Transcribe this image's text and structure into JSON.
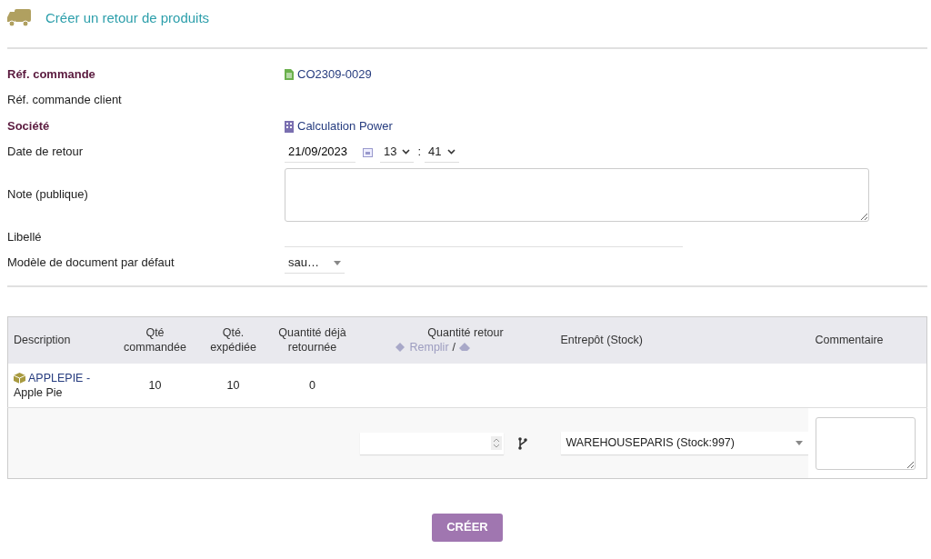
{
  "page_title": "Créer un retour de produits",
  "fields": [
    {
      "kind": "doc-link",
      "label": "Réf. commande",
      "required": true,
      "value": "CO2309-0029"
    },
    {
      "kind": "empty",
      "label": "Réf. commande client",
      "required": false
    },
    {
      "kind": "company-link",
      "label": "Société",
      "required": true,
      "value": "Calculation Power"
    },
    {
      "kind": "datetime",
      "label": "Date de retour",
      "required": false,
      "date": "21/09/2023",
      "hour": "13",
      "separator": ":",
      "minute": "41"
    },
    {
      "kind": "textarea",
      "label": "Note (publique)",
      "required": false
    },
    {
      "kind": "text",
      "label": "Libellé",
      "required": false
    },
    {
      "kind": "select",
      "label": "Modèle de document par défaut",
      "required": false,
      "value": "sau…"
    }
  ],
  "table": {
    "columns": [
      "Description",
      "Qté commandée",
      "Qté. expédiée",
      "Quantité déjà retournée",
      "Quantité retour",
      "Entrepôt (Stock)",
      "Commentaire"
    ],
    "fill_link": "Remplir",
    "fill_separator": "/",
    "rows": [
      {
        "ref": "APPLEPIE -",
        "name": "Apple Pie",
        "ordered": "10",
        "shipped": "10",
        "returned": "0",
        "warehouse": "WAREHOUSEPARIS (Stock:997)"
      }
    ]
  },
  "submit": "CRÉER"
}
